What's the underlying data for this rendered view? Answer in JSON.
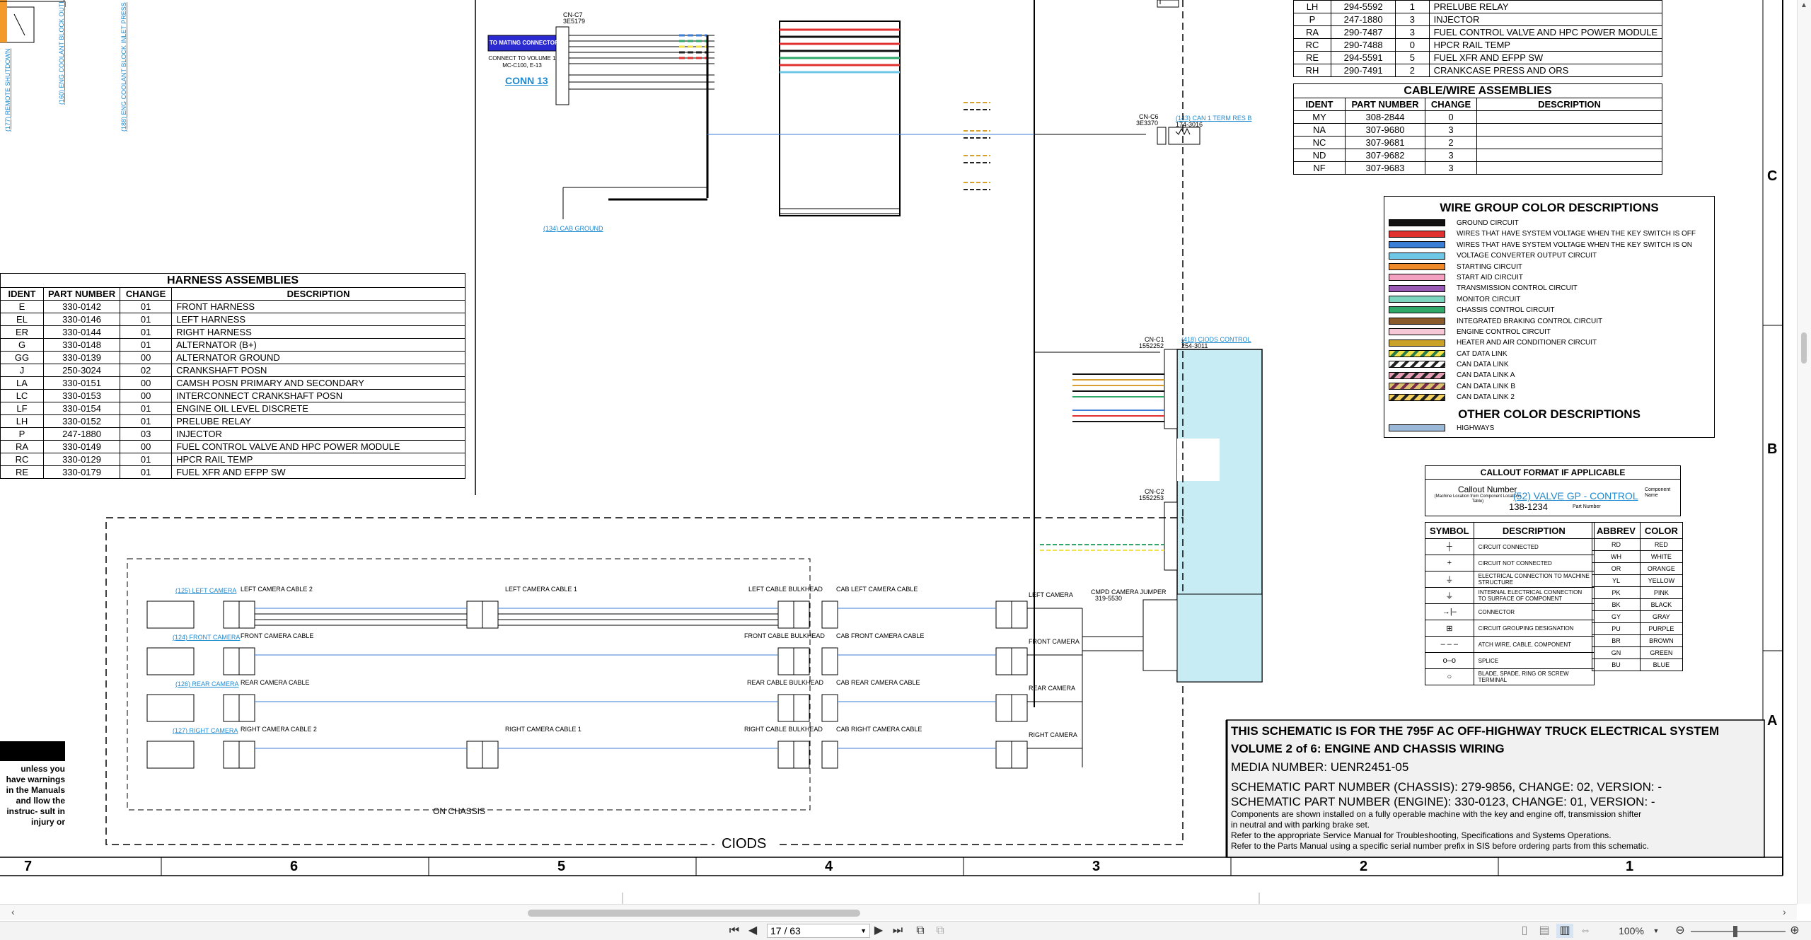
{
  "schematic": {
    "conn_label": "CONNECT TO VOLUME 1 MC-C100, E-13",
    "conn_name": "CONN 13",
    "mating_connector": "TO MATING CONNECTOR",
    "cnc7": "CN-C7",
    "cnc7_pn": "3E5179",
    "cab_ground": "(134) CAB GROUND",
    "can1_term": "(143) CAN 1 TERM RES B",
    "can1_pn": "174-3016",
    "cnc6": "CN-C6",
    "cnc6_pn": "3E3370",
    "ciods_control": "(418) CIODS CONTROL",
    "ciods_pn": "254-3011",
    "cnc1": "CN-C1",
    "cnc1_pn": "1552252",
    "cnc2": "CN-C2",
    "cnc2_pn": "1552253",
    "cmpd_jumper": "CMPD CAMERA JUMPER",
    "cmpd_pn": "319-5530",
    "remote_shutdown": "(177) REMOTE SHUTDOWN",
    "eng_cool_outlet": "(160) ENG COOLANT BLOCK OUTLET",
    "eng_cool_inlet": "(188) ENG COOLANT BLOCK INLET PRESS",
    "on_chassis": "ON CHASSIS",
    "ciods": "CIODS",
    "left_camera": "(125) LEFT CAMERA",
    "front_camera": "(124) FRONT CAMERA",
    "rear_camera": "(126) REAR CAMERA",
    "right_camera": "(127) RIGHT CAMERA",
    "left_cam_cable2": "LEFT CAMERA CABLE 2",
    "left_cam_cable1": "LEFT CAMERA CABLE 1",
    "left_cable_bulkhead": "LEFT CABLE BULKHEAD",
    "cab_left_cam_cable": "CAB LEFT CAMERA CABLE",
    "front_cam_cable": "FRONT CAMERA CABLE",
    "front_cable_bulkhead": "FRONT CABLE BULKHEAD",
    "cab_front_cam_cable": "CAB FRONT CAMERA CABLE",
    "rear_cam_cable": "REAR CAMERA CABLE",
    "rear_cable_bulkhead": "REAR CABLE BULKHEAD",
    "cab_rear_cam_cable": "CAB REAR CAMERA CABLE",
    "right_cam_cable2": "RIGHT CAMERA CABLE 2",
    "right_cam_cable1": "RIGHT CAMERA CABLE 1",
    "right_cable_bulkhead": "RIGHT CABLE BULKHEAD",
    "cab_right_cam_cable": "CAB RIGHT CAMERA CABLE",
    "left_camera_r": "LEFT CAMERA",
    "front_camera_r": "FRONT CAMERA",
    "rear_camera_r": "REAR CAMERA",
    "right_camera_r": "RIGHT CAMERA",
    "warning_text": "unless you have warnings in the Manuals and llow the instruc- sult in injury or",
    "zones_bottom": [
      "7",
      "6",
      "5",
      "4",
      "3",
      "2",
      "1"
    ],
    "zones_right": [
      "C",
      "B",
      "A"
    ]
  },
  "harness": {
    "title": "HARNESS ASSEMBLIES",
    "headers": [
      "IDENT",
      "PART NUMBER",
      "CHANGE",
      "DESCRIPTION"
    ],
    "rows": [
      [
        "E",
        "330-0142",
        "01",
        "FRONT HARNESS"
      ],
      [
        "EL",
        "330-0146",
        "01",
        "LEFT HARNESS"
      ],
      [
        "ER",
        "330-0144",
        "01",
        "RIGHT HARNESS"
      ],
      [
        "G",
        "330-0148",
        "01",
        "ALTERNATOR (B+)"
      ],
      [
        "GG",
        "330-0139",
        "00",
        "ALTERNATOR GROUND"
      ],
      [
        "J",
        "250-3024",
        "02",
        "CRANKSHAFT POSN"
      ],
      [
        "LA",
        "330-0151",
        "00",
        "CAMSH POSN PRIMARY AND SECONDARY"
      ],
      [
        "LC",
        "330-0153",
        "00",
        "INTERCONNECT CRANKSHAFT POSN"
      ],
      [
        "LF",
        "330-0154",
        "01",
        "ENGINE OIL LEVEL DISCRETE"
      ],
      [
        "LH",
        "330-0152",
        "01",
        "PRELUBE RELAY"
      ],
      [
        "P",
        "247-1880",
        "03",
        "INJECTOR"
      ],
      [
        "RA",
        "330-0149",
        "00",
        "FUEL CONTROL VALVE AND HPC POWER MODULE"
      ],
      [
        "RC",
        "330-0129",
        "01",
        "HPCR RAIL TEMP"
      ],
      [
        "RE",
        "330-0179",
        "01",
        "FUEL XFR AND EFPP SW"
      ]
    ]
  },
  "top_right": {
    "rows": [
      [
        "LH",
        "294-5592",
        "1",
        "PRELUBE RELAY"
      ],
      [
        "P",
        "247-1880",
        "3",
        "INJECTOR"
      ],
      [
        "RA",
        "290-7487",
        "3",
        "FUEL CONTROL VALVE AND HPC POWER MODULE"
      ],
      [
        "RC",
        "290-7488",
        "0",
        "HPCR RAIL TEMP"
      ],
      [
        "RE",
        "294-5591",
        "5",
        "FUEL XFR AND EFPP SW"
      ],
      [
        "RH",
        "290-7491",
        "2",
        "CRANKCASE PRESS AND ORS"
      ]
    ]
  },
  "cable": {
    "title": "CABLE/WIRE ASSEMBLIES",
    "headers": [
      "IDENT",
      "PART NUMBER",
      "CHANGE",
      "DESCRIPTION"
    ],
    "rows": [
      [
        "MY",
        "308-2844",
        "0",
        ""
      ],
      [
        "NA",
        "307-9680",
        "3",
        ""
      ],
      [
        "NC",
        "307-9681",
        "2",
        ""
      ],
      [
        "ND",
        "307-9682",
        "3",
        ""
      ],
      [
        "NF",
        "307-9683",
        "3",
        ""
      ]
    ]
  },
  "wire_colors": {
    "title": "WIRE GROUP COLOR DESCRIPTIONS",
    "items": [
      {
        "label": "GROUND CIRCUIT",
        "color": "#111111",
        "stripe": ""
      },
      {
        "label": "WIRES THAT HAVE SYSTEM VOLTAGE WHEN THE KEY SWITCH IS OFF",
        "color": "#e03030",
        "stripe": ""
      },
      {
        "label": "WIRES THAT HAVE SYSTEM VOLTAGE WHEN THE KEY SWITCH IS ON",
        "color": "#3b7ed6",
        "stripe": ""
      },
      {
        "label": "VOLTAGE CONVERTER OUTPUT CIRCUIT",
        "color": "#6fc7e8",
        "stripe": ""
      },
      {
        "label": "STARTING CIRCUIT",
        "color": "#ef8a2a",
        "stripe": ""
      },
      {
        "label": "START AID CIRCUIT",
        "color": "#f4a0c0",
        "stripe": ""
      },
      {
        "label": "TRANSMISSION CONTROL CIRCUIT",
        "color": "#9b59b6",
        "stripe": ""
      },
      {
        "label": "MONITOR CIRCUIT",
        "color": "#7fd6c0",
        "stripe": ""
      },
      {
        "label": "CHASSIS CONTROL CIRCUIT",
        "color": "#2fa86a",
        "stripe": ""
      },
      {
        "label": "INTEGRATED BRAKING CONTROL CIRCUIT",
        "color": "#8a5a2b",
        "stripe": ""
      },
      {
        "label": "ENGINE CONTROL CIRCUIT",
        "color": "#f6c7d7",
        "stripe": ""
      },
      {
        "label": "HEATER AND AIR CONDITIONER CIRCUIT",
        "color": "#c9a227",
        "stripe": ""
      },
      {
        "label": "CAT DATA LINK",
        "color": "#f2e24a",
        "stripe": "#2a7a4a"
      },
      {
        "label": "CAN DATA LINK",
        "color": "#ffffff",
        "stripe": "#222222"
      },
      {
        "label": "CAN DATA LINK A",
        "color": "#e8a0b8",
        "stripe": "#222222"
      },
      {
        "label": "CAN DATA LINK B",
        "color": "#d8c070",
        "stripe": "#7a2a4a"
      },
      {
        "label": "CAN DATA LINK 2",
        "color": "#f2d060",
        "stripe": "#222222"
      }
    ],
    "other_title": "OTHER COLOR DESCRIPTIONS",
    "other_items": [
      {
        "label": "HIGHWAYS",
        "color": "#9ab8d8",
        "stripe": ""
      }
    ]
  },
  "callout": {
    "title": "CALLOUT FORMAT IF APPLICABLE",
    "callout_number": "Callout Number",
    "callout_number_sub": "(Machine Location from Component Locations Table)",
    "example_name": "(52) VALVE GP - CONTROL",
    "component_name": "Component Name",
    "example_part": "138-1234",
    "part_number": "Part Number"
  },
  "symbols": {
    "headers": [
      "SYMBOL",
      "DESCRIPTION"
    ],
    "items": [
      {
        "icon": "circuit-connected-icon",
        "glyph": "┼",
        "desc": "CIRCUIT CONNECTED"
      },
      {
        "icon": "circuit-not-connected-icon",
        "glyph": "+",
        "desc": "CIRCUIT NOT CONNECTED"
      },
      {
        "icon": "machine-structure-icon",
        "glyph": "⏚",
        "desc": "ELECTRICAL CONNECTION TO MACHINE STRUCTURE"
      },
      {
        "icon": "component-surface-icon",
        "glyph": "⏚",
        "desc": "INTERNAL ELECTRICAL CONNECTION TO SURFACE OF COMPONENT"
      },
      {
        "icon": "connector-icon",
        "glyph": "→|–",
        "desc": "CONNECTOR"
      },
      {
        "icon": "grouping-icon",
        "glyph": "⊞",
        "desc": "CIRCUIT GROUPING DESIGNATION"
      },
      {
        "icon": "attach-wire-icon",
        "glyph": "– – –",
        "desc": "ATCH WIRE, CABLE, COMPONENT"
      },
      {
        "icon": "splice-icon",
        "glyph": "o–o",
        "desc": "SPLICE"
      },
      {
        "icon": "terminal-icon",
        "glyph": "○",
        "desc": "BLADE, SPADE, RING OR SCREW TERMINAL"
      }
    ]
  },
  "abbrev": {
    "headers": [
      "ABBREV",
      "COLOR"
    ],
    "rows": [
      [
        "RD",
        "RED"
      ],
      [
        "WH",
        "WHITE"
      ],
      [
        "OR",
        "ORANGE"
      ],
      [
        "YL",
        "YELLOW"
      ],
      [
        "PK",
        "PINK"
      ],
      [
        "BK",
        "BLACK"
      ],
      [
        "GY",
        "GRAY"
      ],
      [
        "PU",
        "PURPLE"
      ],
      [
        "BR",
        "BROWN"
      ],
      [
        "GN",
        "GREEN"
      ],
      [
        "BU",
        "BLUE"
      ]
    ]
  },
  "title_block": {
    "line1": "THIS SCHEMATIC IS FOR THE 795F AC OFF-HIGHWAY TRUCK ELECTRICAL SYSTEM",
    "line2": "VOLUME 2 of 6: ENGINE AND CHASSIS WIRING",
    "media": "MEDIA NUMBER: UENR2451-05",
    "chassis": "SCHEMATIC PART NUMBER (CHASSIS): 279-9856, CHANGE: 02, VERSION: -",
    "engine": "SCHEMATIC PART NUMBER (ENGINE): 330-0123, CHANGE: 01, VERSION: -",
    "note1": "Components are shown installed on a fully operable machine with the key and engine off, transmission shifter",
    "note2": "in neutral and with parking brake set.",
    "note3": "Refer to the appropriate Service Manual for Troubleshooting, Specifications and Systems Operations.",
    "note4": "Refer to the Parts Manual using a specific serial number prefix in SIS before ordering parts from this schematic."
  },
  "viewer": {
    "page_value": "17 / 63",
    "zoom": "100%"
  }
}
